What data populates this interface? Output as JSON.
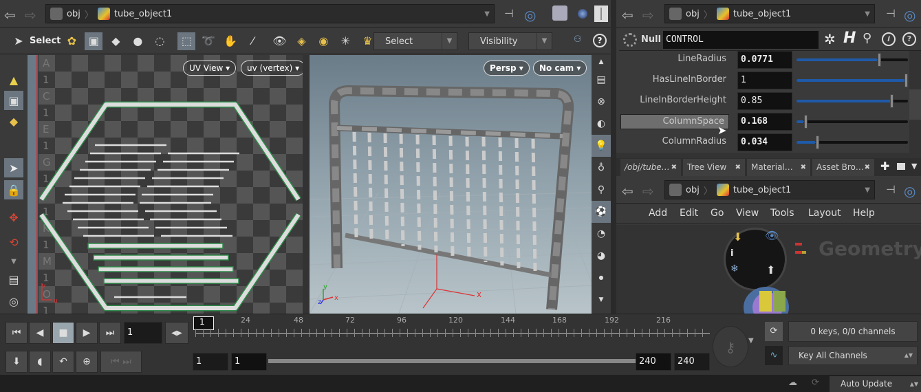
{
  "left_path": {
    "root": "obj",
    "node": "tube_object1"
  },
  "toolbar": {
    "select_label": "Select",
    "select_mode": "Select",
    "visibility": "Visibility"
  },
  "uv_view": {
    "view_menu": "UV View",
    "attribute_menu": "uv (vertex)",
    "axis_u": "u",
    "axis_v": "v",
    "grid_rows": [
      "A",
      "1",
      "C",
      "1",
      "E",
      "1",
      "G",
      "1",
      "I",
      "1",
      "K",
      "1",
      "M",
      "1",
      "O",
      "1"
    ]
  },
  "viewport": {
    "camera_persp": "Persp",
    "camera_none": "No cam",
    "axis_x": "x",
    "axis_y": "y",
    "axis_z": "z"
  },
  "right_path": {
    "root": "obj",
    "node": "tube_object1"
  },
  "params": {
    "node_type": "Null",
    "node_name": "CONTROL",
    "rows": [
      {
        "label": "LineRadius",
        "value": "0.0771",
        "level": 0.73
      },
      {
        "label": "HasLineInBorder",
        "value": "1",
        "level": 1.0
      },
      {
        "label": "LineInBorderHeight",
        "value": "0.85",
        "level": 0.85
      },
      {
        "label": "ColumnSpace",
        "value": "0.168",
        "level": 0.07
      },
      {
        "label": "ColumnRadius",
        "value": "0.034",
        "level": 0.17
      }
    ]
  },
  "tabs": [
    {
      "label": "/obj/tube…"
    },
    {
      "label": "Tree View"
    },
    {
      "label": "Material…"
    },
    {
      "label": "Asset Bro…"
    }
  ],
  "network_path": {
    "root": "obj",
    "node": "tube_object1"
  },
  "network_menu": [
    "Add",
    "Edit",
    "Go",
    "View",
    "Tools",
    "Layout",
    "Help"
  ],
  "network": {
    "watermark": "Geometry"
  },
  "timeline": {
    "current_frame": "1",
    "frame_marker": "1",
    "ticks": [
      "24",
      "48",
      "72",
      "96",
      "120",
      "144",
      "168",
      "192",
      "216"
    ],
    "range_start": "1",
    "playback_start": "1",
    "playback_end": "240",
    "range_end": "240",
    "keys_status": "0 keys, 0/0 channels",
    "key_mode": "Key All Channels"
  },
  "status": {
    "update_mode": "Auto Update"
  },
  "colors": {
    "accent_blue": "#1f5aa8",
    "uv_border": "#2e8a4a",
    "background": "#3a3a3a"
  }
}
